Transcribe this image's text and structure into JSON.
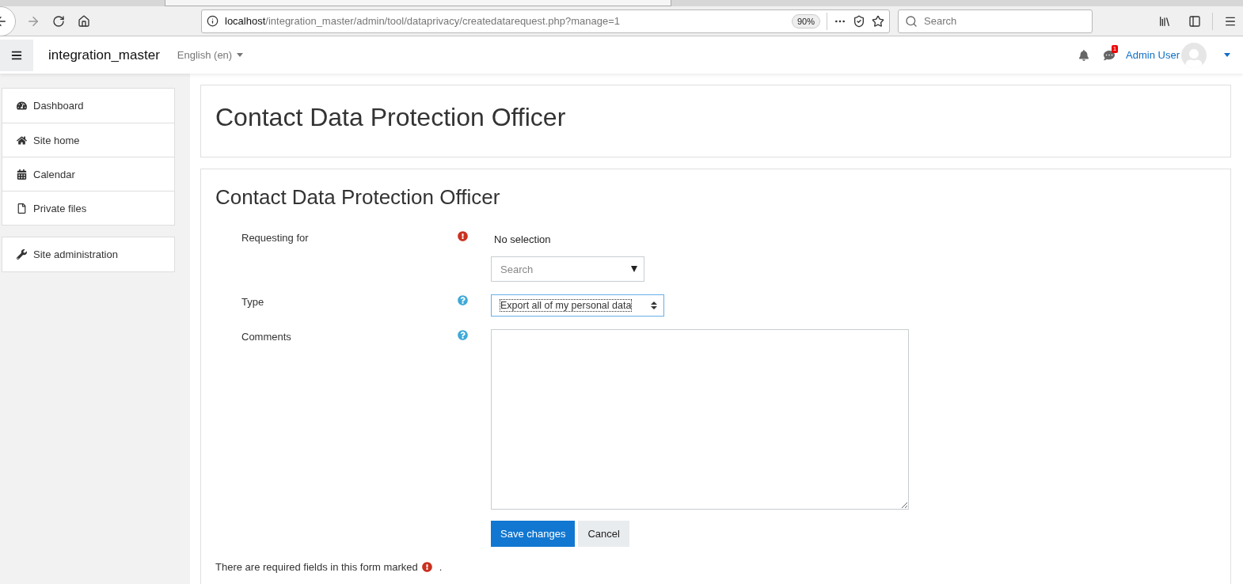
{
  "browser": {
    "url_host": "localhost",
    "url_path": "/integration_master/admin/tool/dataprivacy/createdatarequest.php?manage=1",
    "zoom": "90%",
    "search_placeholder": "Search"
  },
  "navbar": {
    "site_name": "integration_master",
    "language": "English (en)",
    "message_count": "1",
    "user_name": "Admin User"
  },
  "sidebar": {
    "groups": [
      {
        "items": [
          {
            "kind": "dashboard",
            "label": "Dashboard"
          },
          {
            "kind": "home",
            "label": "Site home"
          },
          {
            "kind": "calendar",
            "label": "Calendar"
          },
          {
            "kind": "file",
            "label": "Private files"
          }
        ]
      },
      {
        "items": [
          {
            "kind": "wrench",
            "label": "Site administration"
          }
        ]
      }
    ]
  },
  "page_header": {
    "title": "Contact Data Protection Officer"
  },
  "form": {
    "title": "Contact Data Protection Officer",
    "fields": [
      {
        "kind": "autocomplete",
        "label": "Requesting for",
        "required": true,
        "selection": "No selection",
        "placeholder": "Search"
      },
      {
        "kind": "select",
        "label": "Type",
        "required": false,
        "value": "Export all of my personal data"
      },
      {
        "kind": "textarea",
        "label": "Comments",
        "required": false
      }
    ],
    "buttons": [
      {
        "kind": "primary",
        "label": "Save changes"
      },
      {
        "kind": "secondary",
        "label": "Cancel"
      }
    ],
    "required_note": {
      "before": "There are required fields in this form marked",
      "after": "."
    }
  }
}
